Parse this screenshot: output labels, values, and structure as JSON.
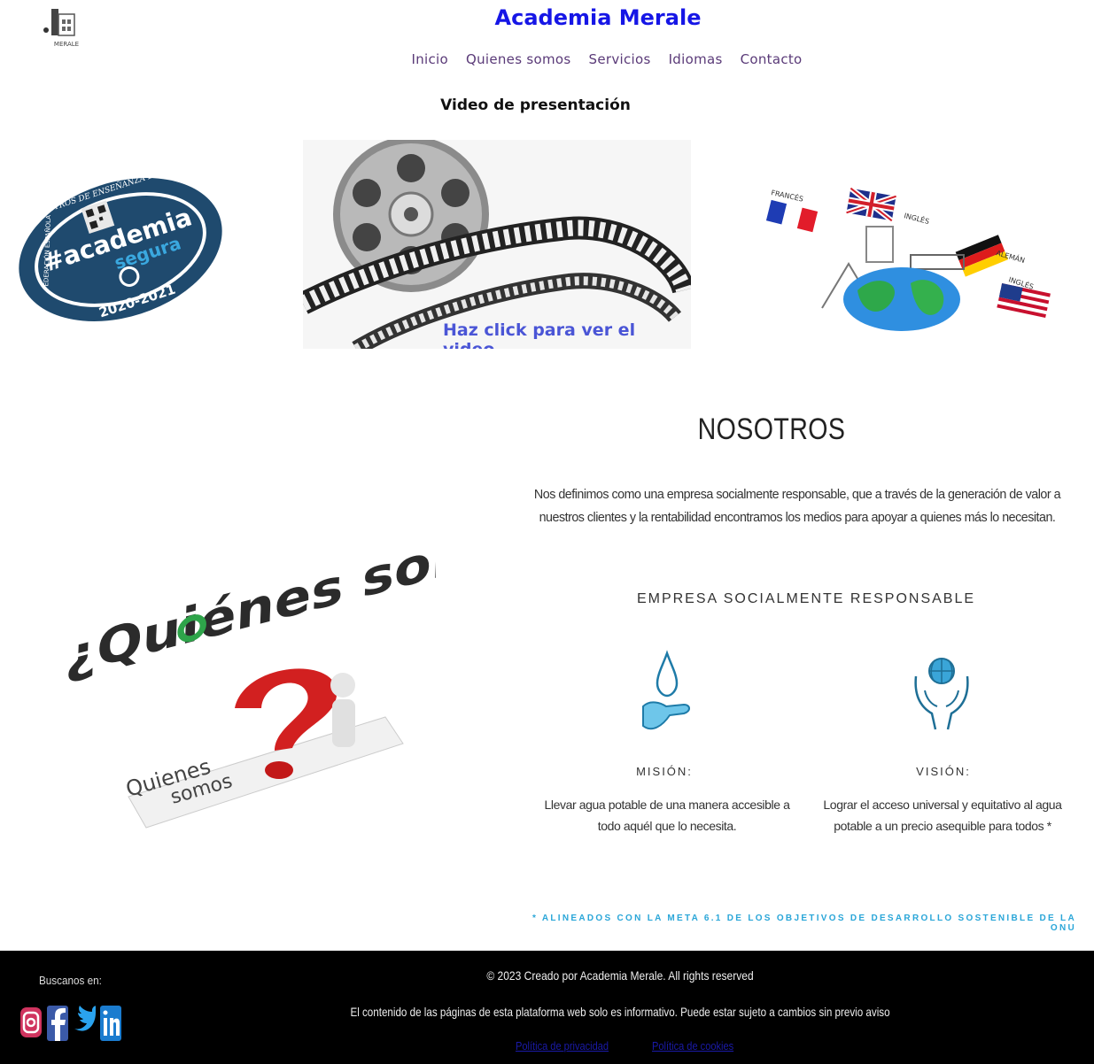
{
  "header": {
    "logo_text": "MERALE",
    "title": "Academia Merale",
    "nav": [
      "Inicio",
      "Quienes somos",
      "Servicios",
      "Idiomas",
      "Contacto"
    ]
  },
  "video_section": {
    "heading": "Video de presentación",
    "cta": "Haz click para ver el video"
  },
  "badge": {
    "top_arc": "DE CENTROS DE ENSEÑANZA DE IDIOMAS",
    "left_arc": "FEDERACIÓN ESPAÑOLA",
    "main": "#academia",
    "sub": "segura",
    "years": "2020-2021"
  },
  "languages": {
    "labels": [
      "FRANCÉS",
      "INGLÉS",
      "ALEMÁN",
      "INGLÉS"
    ]
  },
  "quienes": {
    "big_text": "¿Quiénes somos?",
    "small_text_1": "Quienes",
    "small_text_2": "somos"
  },
  "nosotros": {
    "title": "NOSOTROS",
    "description_1": "Nos definimos como una empresa socialmente responsable, que a través de la generación de valor a",
    "description_2": "nuestros clientes y la rentabilidad encontramos los medios para apoyar a quienes más lo necesitan.",
    "esr_title": "EMPRESA SOCIALMENTE RESPONSABLE",
    "mision_label": "MISIÓN:",
    "mision_text_1": "Llevar agua potable de una manera accesible a",
    "mision_text_2": "todo aquél que lo necesita.",
    "vision_label": "VISIÓN:",
    "vision_text_1": "Lograr el acceso universal y equitativo al agua",
    "vision_text_2": "potable a un precio asequible para todos *",
    "ods_note": "* ALINEADOS CON LA META 6.1 DE LOS OBJETIVOS DE DESARROLLO SOSTENIBLE DE LA ONU"
  },
  "footer": {
    "follow": "Buscanos en:",
    "copyright": "© 2023 Creado por Academia Merale. All rights reserved",
    "disclaimer": "El contenido de las páginas de esta plataforma web solo es informativo. Puede estar sujeto a cambios sin previo aviso",
    "privacy": "Política de privacidad",
    "cookies": "Política de cookies"
  },
  "colors": {
    "title_blue": "#1616e6",
    "nav_purple": "#5a3a78",
    "cta_blue": "#4a55d6",
    "badge_navy": "#1f4a6e",
    "footer_bg": "#000000",
    "accent_cyan": "#2aa6d8"
  }
}
